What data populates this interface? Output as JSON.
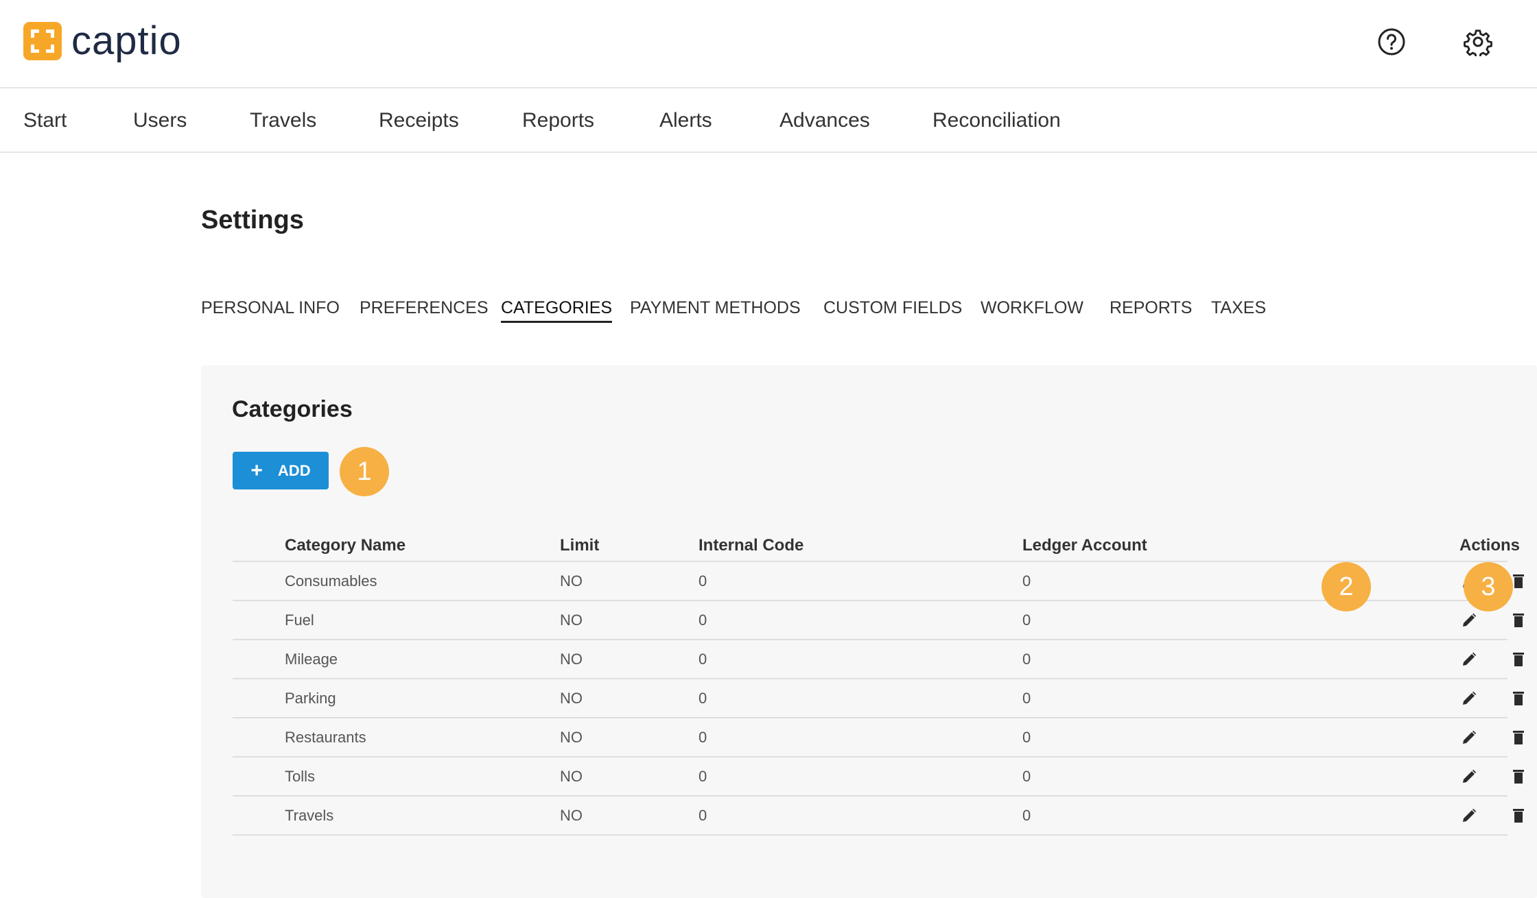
{
  "brand": {
    "name": "captio",
    "accent": "#f7a727"
  },
  "header": {
    "help_icon": "help-circle-icon",
    "settings_icon": "gear-icon"
  },
  "main_nav": [
    {
      "label": "Start"
    },
    {
      "label": "Users"
    },
    {
      "label": "Travels"
    },
    {
      "label": "Receipts"
    },
    {
      "label": "Reports"
    },
    {
      "label": "Alerts"
    },
    {
      "label": "Advances"
    },
    {
      "label": "Reconciliation"
    }
  ],
  "settings": {
    "title": "Settings",
    "tabs": [
      {
        "label": "PERSONAL INFO",
        "active": false
      },
      {
        "label": "PREFERENCES",
        "active": false
      },
      {
        "label": "CATEGORIES",
        "active": true
      },
      {
        "label": "PAYMENT METHODS",
        "active": false
      },
      {
        "label": "CUSTOM FIELDS",
        "active": false
      },
      {
        "label": "WORKFLOW",
        "active": false
      },
      {
        "label": "REPORTS",
        "active": false
      },
      {
        "label": "TAXES",
        "active": false
      }
    ]
  },
  "categories": {
    "title": "Categories",
    "add_button": {
      "icon": "+",
      "label": "ADD",
      "color": "#1c8fd6"
    },
    "columns": {
      "name": "Category Name",
      "limit": "Limit",
      "code": "Internal Code",
      "ledger": "Ledger Account",
      "actions": "Actions"
    },
    "rows": [
      {
        "name": "Consumables",
        "limit": "NO",
        "code": "0",
        "ledger": "0"
      },
      {
        "name": "Fuel",
        "limit": "NO",
        "code": "0",
        "ledger": "0"
      },
      {
        "name": "Mileage",
        "limit": "NO",
        "code": "0",
        "ledger": "0"
      },
      {
        "name": "Parking",
        "limit": "NO",
        "code": "0",
        "ledger": "0"
      },
      {
        "name": "Restaurants",
        "limit": "NO",
        "code": "0",
        "ledger": "0"
      },
      {
        "name": "Tolls",
        "limit": "NO",
        "code": "0",
        "ledger": "0"
      },
      {
        "name": "Travels",
        "limit": "NO",
        "code": "0",
        "ledger": "0"
      }
    ],
    "action_icons": {
      "edit": "pencil-icon",
      "delete": "trash-icon"
    }
  },
  "callouts": [
    {
      "label": "1",
      "color": "#f7b044"
    },
    {
      "label": "2",
      "color": "#f7b044"
    },
    {
      "label": "3",
      "color": "#f7b044"
    }
  ]
}
